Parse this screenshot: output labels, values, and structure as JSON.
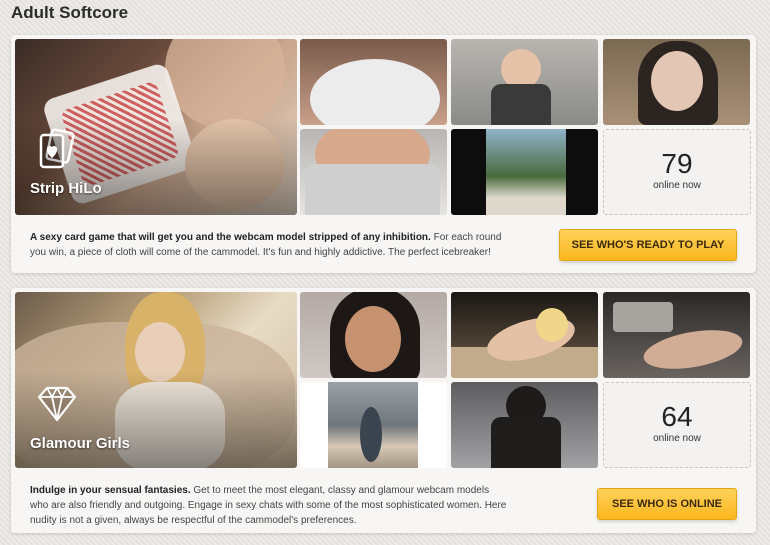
{
  "page": {
    "title": "Adult Softcore"
  },
  "sections": [
    {
      "hero_label": "Strip HiLo",
      "hero_icon": "playing-card-heart-icon",
      "online_count": "79",
      "online_label": "online now",
      "desc_bold": "A sexy card game that will get you and the webcam model stripped of any inhibition.",
      "desc_rest": "For each round you win, a piece of cloth will come of the cammodel. It's fun and highly addictive. The perfect icebreaker!",
      "cta_label": "SEE WHO'S READY TO PLAY"
    },
    {
      "hero_label": "Glamour Girls",
      "hero_icon": "diamond-icon",
      "online_count": "64",
      "online_label": "online now",
      "desc_bold": "Indulge in your sensual fantasies.",
      "desc_rest": "Get to meet the most elegant, classy and glamour webcam models who are also friendly and outgoing. Engage in sexy chats with some of the most sophisticated women. Here nudity is not a given, always be respectful of the cammodel's preferences.",
      "cta_label": "SEE WHO IS ONLINE"
    }
  ],
  "colors": {
    "cta": "#fbb61e",
    "background": "#e8e5e0",
    "card": "#f7f6f4"
  }
}
